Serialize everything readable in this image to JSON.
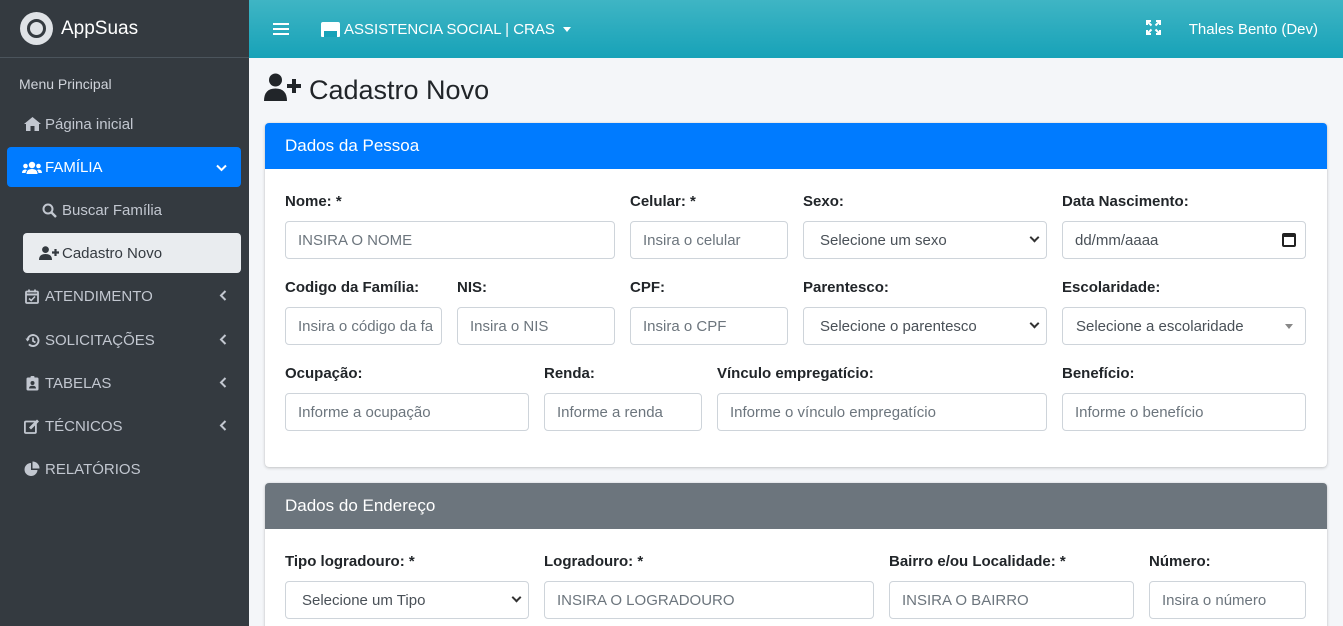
{
  "brand": {
    "name": "AppSuas"
  },
  "sidebar": {
    "header": "Menu Principal",
    "items": [
      {
        "label": "Página inicial",
        "icon": "home-icon"
      },
      {
        "label": "FAMÍLIA",
        "icon": "users-icon"
      },
      {
        "label": "Buscar Família",
        "icon": "search-icon"
      },
      {
        "label": "Cadastro Novo",
        "icon": "user-plus-icon"
      },
      {
        "label": "ATENDIMENTO",
        "icon": "calendar-check-icon"
      },
      {
        "label": "SOLICITAÇÕES",
        "icon": "history-icon"
      },
      {
        "label": "TABELAS",
        "icon": "id-badge-icon"
      },
      {
        "label": "TÉCNICOS",
        "icon": "edit-icon"
      },
      {
        "label": "RELATÓRIOS",
        "icon": "chart-pie-icon"
      }
    ]
  },
  "navbar": {
    "unit": "ASSISTENCIA SOCIAL | CRAS",
    "user": "Thales Bento (Dev)"
  },
  "page": {
    "title": "Cadastro Novo"
  },
  "pessoa": {
    "header": "Dados da Pessoa",
    "nome_label": "Nome: *",
    "nome_placeholder": "INSIRA O NOME",
    "celular_label": "Celular: *",
    "celular_placeholder": "Insira o celular",
    "sexo_label": "Sexo:",
    "sexo_value": "Selecione um sexo",
    "nascimento_label": "Data Nascimento:",
    "nascimento_value": "dd/mm/aaaa",
    "codigo_label": "Codigo da Família:",
    "codigo_placeholder": "Insira o código da fa",
    "nis_label": "NIS:",
    "nis_placeholder": "Insira o NIS",
    "cpf_label": "CPF:",
    "cpf_placeholder": "Insira o CPF",
    "parentesco_label": "Parentesco:",
    "parentesco_value": "Selecione o parentesco",
    "escolaridade_label": "Escolaridade:",
    "escolaridade_value": "Selecione a escolaridade",
    "ocupacao_label": "Ocupação:",
    "ocupacao_placeholder": "Informe a ocupação",
    "renda_label": "Renda:",
    "renda_placeholder": "Informe a renda",
    "vinculo_label": "Vínculo empregatício:",
    "vinculo_placeholder": "Informe o vínculo empregatício",
    "beneficio_label": "Benefício:",
    "beneficio_placeholder": "Informe o benefício"
  },
  "endereco": {
    "header": "Dados do Endereço",
    "tipo_label": "Tipo logradouro: *",
    "tipo_value": "Selecione um Tipo",
    "logradouro_label": "Logradouro: *",
    "logradouro_placeholder": "INSIRA O LOGRADOURO",
    "bairro_label": "Bairro e/ou Localidade: *",
    "bairro_placeholder": "INSIRA O BAIRRO",
    "numero_label": "Número:",
    "numero_placeholder": "Insira o número"
  }
}
